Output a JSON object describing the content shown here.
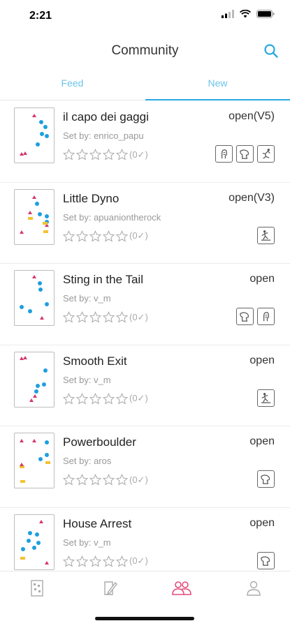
{
  "status_bar": {
    "time": "2:21"
  },
  "header": {
    "title": "Community"
  },
  "tabs": [
    {
      "label": "Feed"
    },
    {
      "label": "New",
      "active": true
    }
  ],
  "colors": {
    "accent": "#29a8e0",
    "hold_red": "#d6366b",
    "hold_blue": "#1d9fe0",
    "hold_yellow": "#f4c232",
    "tab_active": "#e64a7b"
  },
  "problems": [
    {
      "name": "il capo dei gaggi",
      "set_by": "Set by: enrico_papu",
      "grade": "open(V5)",
      "rating": "(0✓)",
      "tags": [
        "crimp-tag-icon",
        "sloper-tag-icon",
        "dyno-tag-icon"
      ]
    },
    {
      "name": "Little Dyno",
      "set_by": "Set by: apuaniontherock",
      "grade": "open(V3)",
      "rating": "(0✓)",
      "tags": [
        "climber-tag-icon"
      ]
    },
    {
      "name": "Sting in the Tail",
      "set_by": "Set by: v_m",
      "grade": "open",
      "rating": "(0✓)",
      "tags": [
        "sloper-tag-icon",
        "crimp-tag-icon"
      ]
    },
    {
      "name": "Smooth Exit",
      "set_by": "Set by: v_m",
      "grade": "open",
      "rating": "(0✓)",
      "tags": [
        "climber-tag-icon"
      ]
    },
    {
      "name": "Powerboulder",
      "set_by": "Set by: aros",
      "grade": "open",
      "rating": "(0✓)",
      "tags": [
        "sloper-tag-icon"
      ]
    },
    {
      "name": "House Arrest",
      "set_by": "Set by: v_m",
      "grade": "open",
      "rating": "(0✓)",
      "tags": [
        "sloper-tag-icon"
      ]
    }
  ],
  "tab_bar": [
    "wall-icon",
    "log-icon",
    "community-icon",
    "profile-icon"
  ]
}
